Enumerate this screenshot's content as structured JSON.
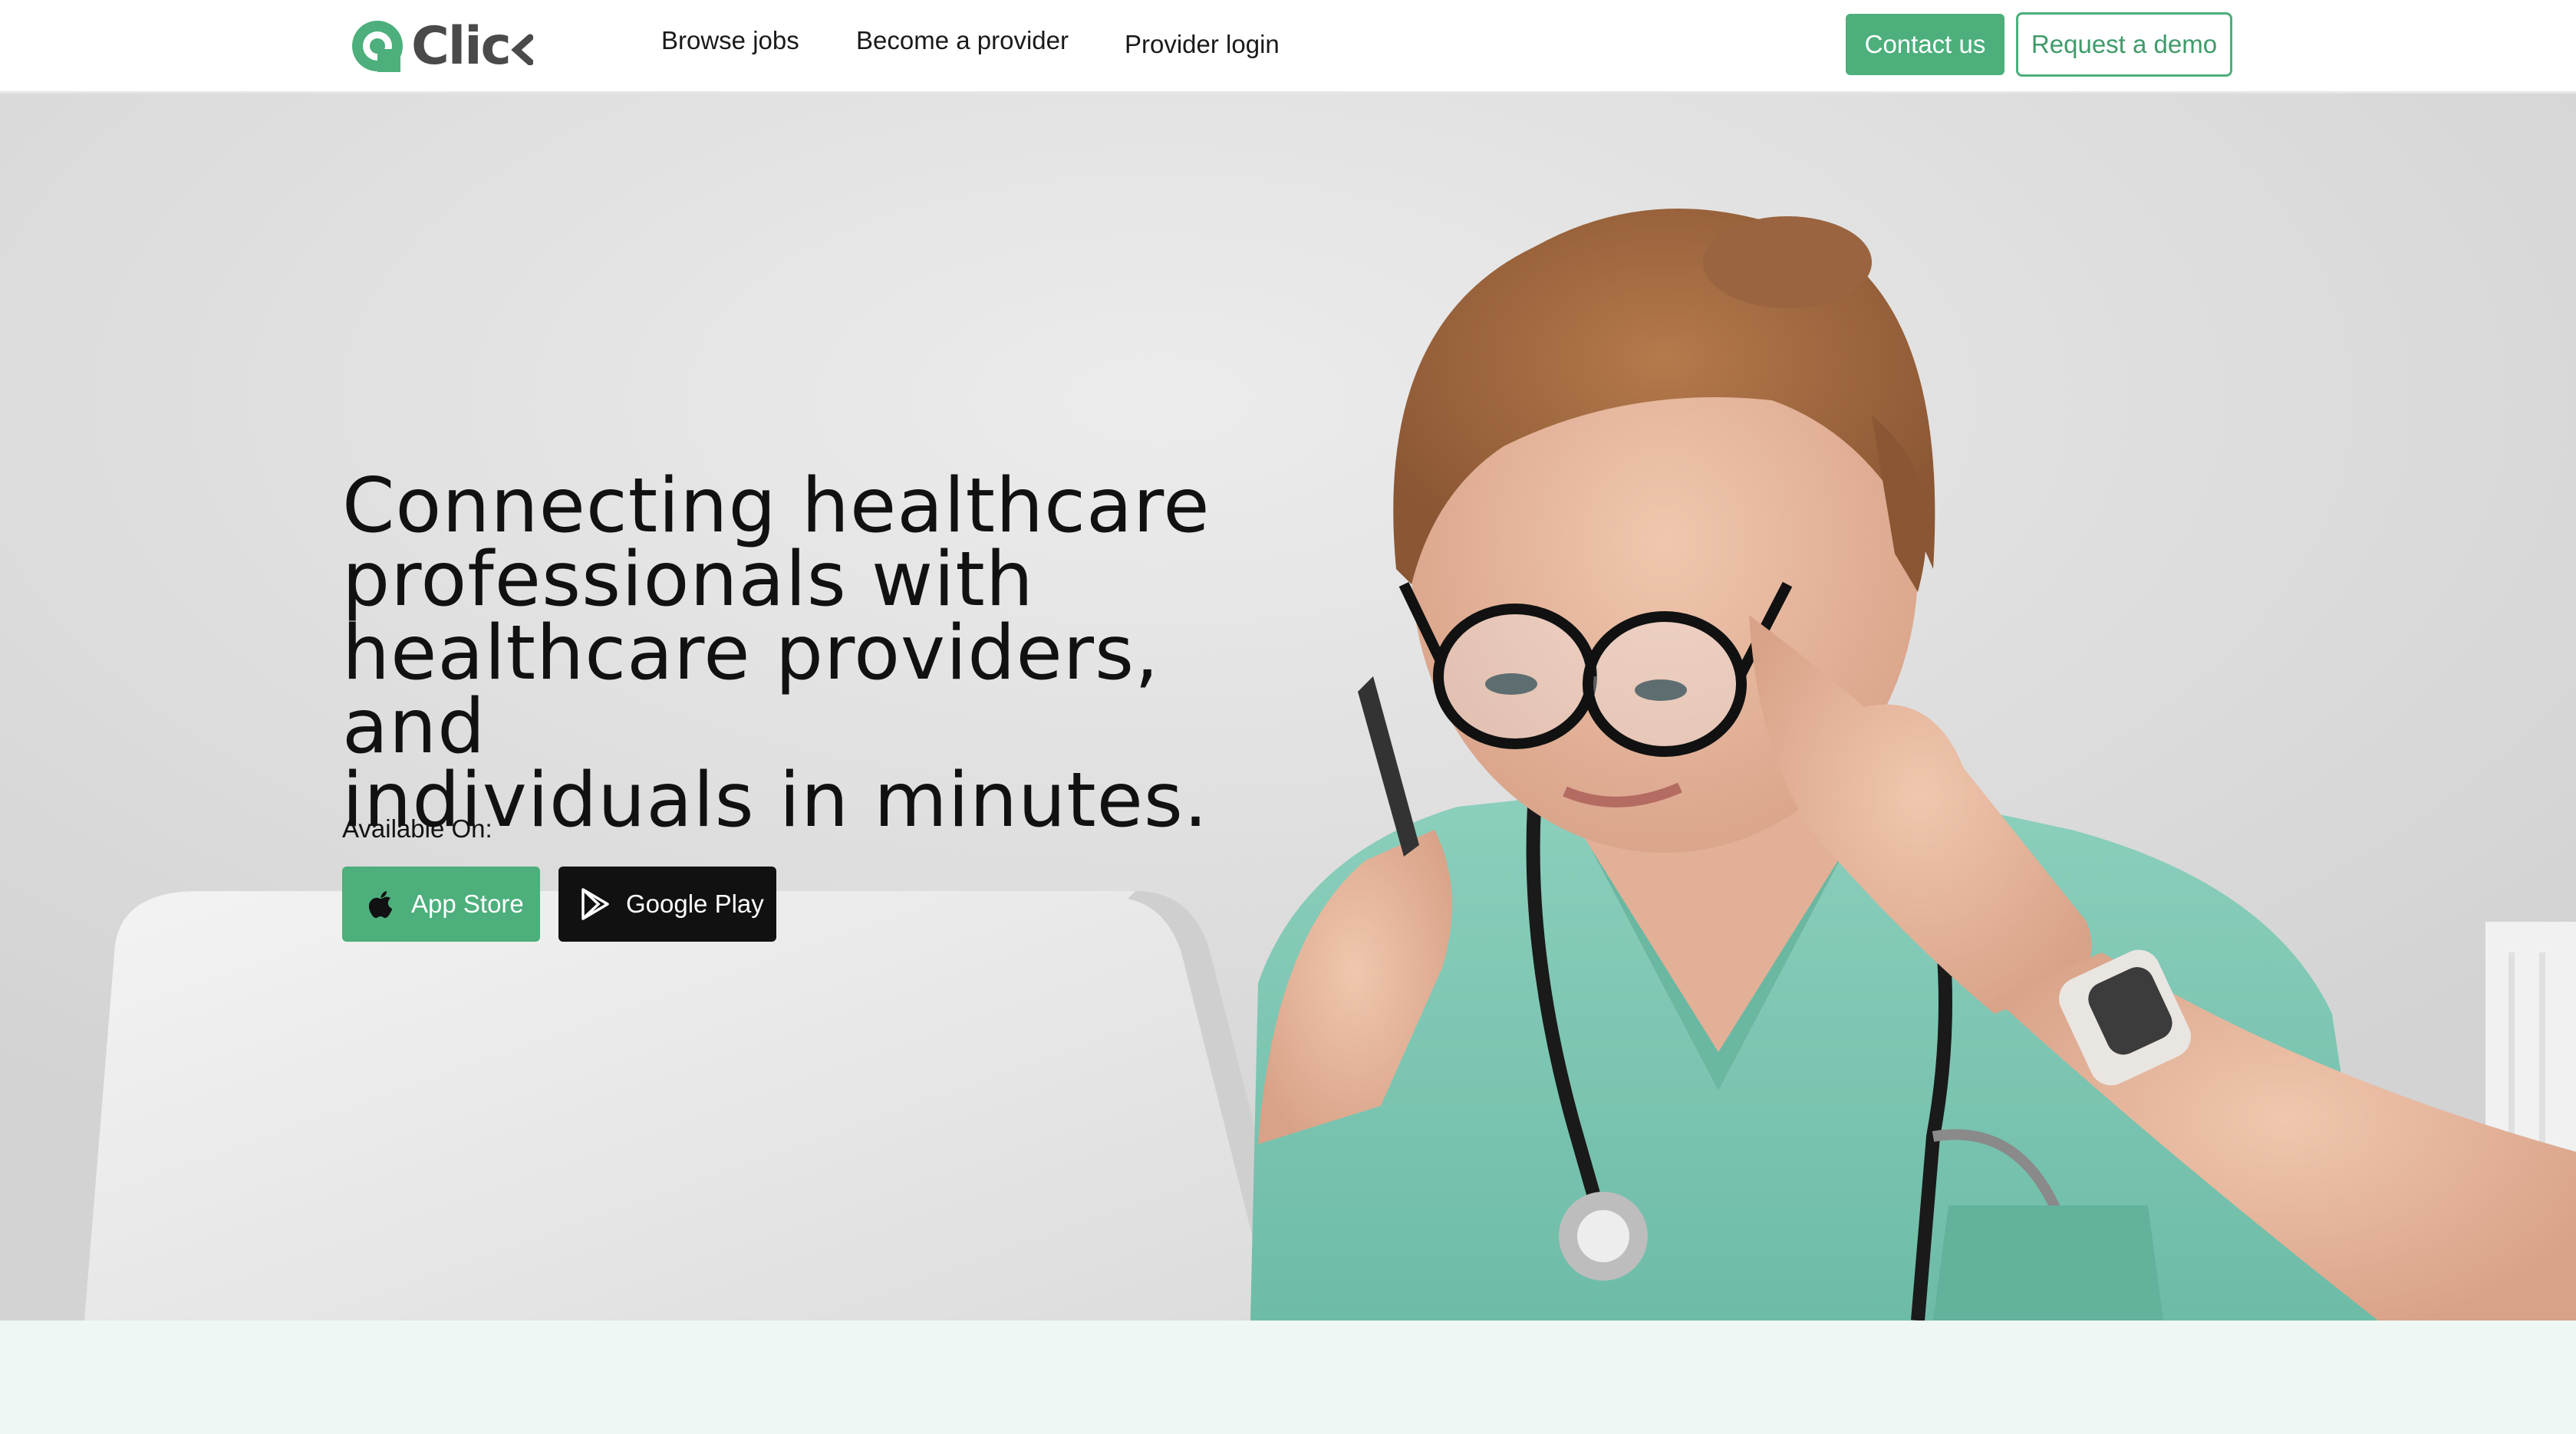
{
  "brand": {
    "name": "Clic",
    "logo_icon": "click-logo-icon",
    "accent_color": "#4caf7c"
  },
  "nav": {
    "links": {
      "browse_jobs": "Browse jobs",
      "become_provider": "Become a provider",
      "provider_login": "Provider login"
    },
    "contact_label": "Contact us",
    "demo_label": "Request a demo"
  },
  "hero": {
    "headline": {
      "line1": "Connecting healthcare",
      "line2": "professionals with",
      "line3": "healthcare providers, and",
      "line4": "individuals in minutes."
    },
    "available_label": "Available On:",
    "app_store_label": "App Store",
    "google_play_label": "Google Play",
    "image_subject": "nurse-with-glasses-photo"
  }
}
